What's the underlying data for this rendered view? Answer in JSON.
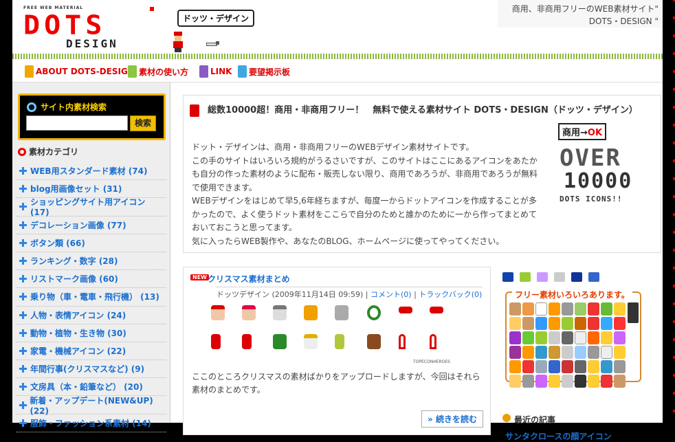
{
  "header": {
    "logo_small": "FREE WEB MATERIAL",
    "logo_main": "DOTS",
    "logo_sub": "DESIGN",
    "speech_bubble": "ドッツ・デザイン",
    "tagline": "商用、非商用フリーのWEB素材サイト\" DOTS・DESIGN \""
  },
  "nav": [
    {
      "label": "ABOUT DOTS-DESIGN",
      "color": "#f0a800"
    },
    {
      "label": "素材の使い方",
      "color": "#8cc63f"
    },
    {
      "label": "LINK",
      "color": "#8a5bc4"
    },
    {
      "label": "要望掲示板",
      "color": "#3fa7e0"
    }
  ],
  "sidebar": {
    "search_title": "サイト内素材検索",
    "search_value": "",
    "search_button": "検索",
    "category_heading": "素材カテゴリ",
    "categories": [
      "WEB用スタンダード素材 (74)",
      "blog用画像セット (31)",
      "ショッピングサイト用アイコン (17)",
      "デコレーション画像 (77)",
      "ボタン類 (66)",
      "ランキング・数字 (28)",
      "リストマーク画像 (60)",
      "乗り物（車・電車・飛行機） (13)",
      "人物・表情アイコン (24)",
      "動物・植物・生き物 (30)",
      "家電・機械アイコン (22)",
      "年間行事(クリスマスなど) (9)",
      "文房具（本・鉛筆など） (20)",
      "新着・アップデート(NEW&UP) (22)",
      "服飾・ファッション系素材 (14)"
    ]
  },
  "intro": {
    "heading": "総数10000超！商用・非商用フリー！　無料で使える素材サイト DOTS・DESIGN（ドッツ・デザイン）",
    "paragraph1": "ドット・デザインは、商用・非商用フリーのWEBデザイン素材サイトです。",
    "paragraph2": "この手のサイトはいろいろ規約がうるさいですが、このサイトはここにあるアイコンをあたかも自分の作った素材のように配布・販売しない限り、商用であろうが、非商用であろうが無料で使用できます。",
    "paragraph3": "WEBデザインをはじめて早5,6年経ちますが、毎度一からドットアイコンを作成することが多かったので、よく使うドット素材をここらで自分のためと誰かのために一から作ってまとめておいておこうと思ってます。",
    "paragraph4": "気に入ったらWEB製作や、あなたのBLOG、ホームページに使ってやってください。",
    "badge_ok_prefix": "商用→",
    "badge_ok": "OK",
    "badge_over": "OVER",
    "badge_number": "10000",
    "badge_icons": "DOTS ICONS!!"
  },
  "post": {
    "new_badge": "NEW",
    "title": "クリスマス素材まとめ",
    "author": "ドッツデザイン",
    "date": "2009年11月14日 09:59",
    "comments": "コメント(0)",
    "trackback": "トラックバック(0)",
    "credit": "TOPECONHEROES",
    "excerpt": "ここのところクリスマスの素材ばかりをアップロードしますが、今回はそれら素材のまとめです。",
    "read_more": "続きを読む"
  },
  "right": {
    "free_title": "フリー素材いろいろあります。",
    "recent_heading": "最近の記事",
    "recent_item": "サンタクロースの顔アイコン"
  }
}
